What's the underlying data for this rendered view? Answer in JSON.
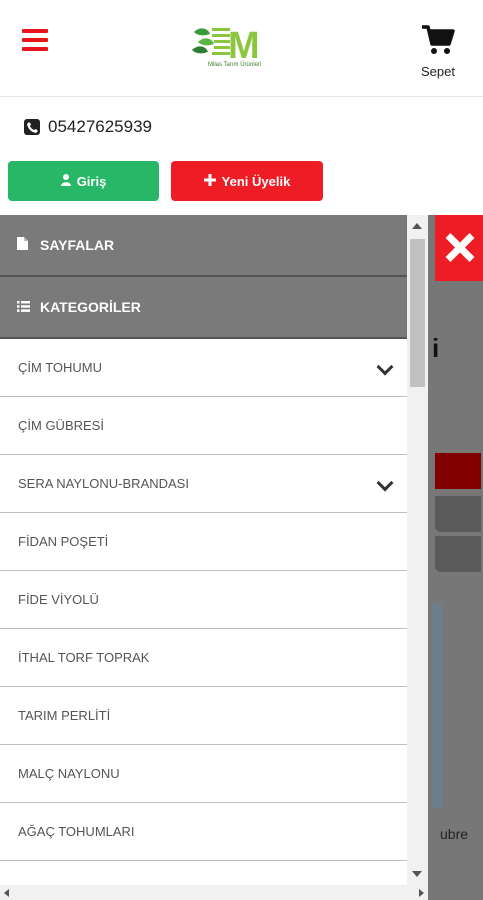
{
  "header": {
    "menu_icon": "hamburger-icon",
    "logo": {
      "letter": "M",
      "tagline": "Milas Tarım Ürünleri"
    },
    "cart": {
      "icon": "cart-icon",
      "label": "Sepet"
    }
  },
  "contact": {
    "phone_icon": "phone-icon",
    "phone": "05427625939"
  },
  "auth": {
    "login": {
      "icon": "user-icon",
      "label": "Giriş",
      "color": "#27b767"
    },
    "register": {
      "icon": "plus-icon",
      "label": "Yeni Üyelik",
      "color": "#ee1c24"
    }
  },
  "menu": {
    "sections": [
      {
        "icon": "page-icon",
        "label": "SAYFALAR"
      },
      {
        "icon": "list-icon",
        "label": "KATEGORİLER"
      }
    ],
    "items": [
      {
        "label": "ÇİM TOHUMU",
        "expandable": true
      },
      {
        "label": "ÇİM GÜBRESİ",
        "expandable": false
      },
      {
        "label": "SERA NAYLONU-BRANDASI",
        "expandable": true
      },
      {
        "label": "FİDAN POŞETİ",
        "expandable": false
      },
      {
        "label": "FİDE VİYOLÜ",
        "expandable": false
      },
      {
        "label": "İTHAL TORF TOPRAK",
        "expandable": false
      },
      {
        "label": "TARIM PERLİTİ",
        "expandable": false
      },
      {
        "label": "MALÇ NAYLONU",
        "expandable": false
      },
      {
        "label": "AĞAÇ TOHUMLARI",
        "expandable": false
      }
    ],
    "close_icon": "close-icon"
  },
  "background": {
    "heading_fragment": "i",
    "text_fragment": "ubre"
  },
  "colors": {
    "accent_red": "#e4161c",
    "menu_section_bg": "#7a7a7a",
    "logo_green": "#8cc63f"
  }
}
